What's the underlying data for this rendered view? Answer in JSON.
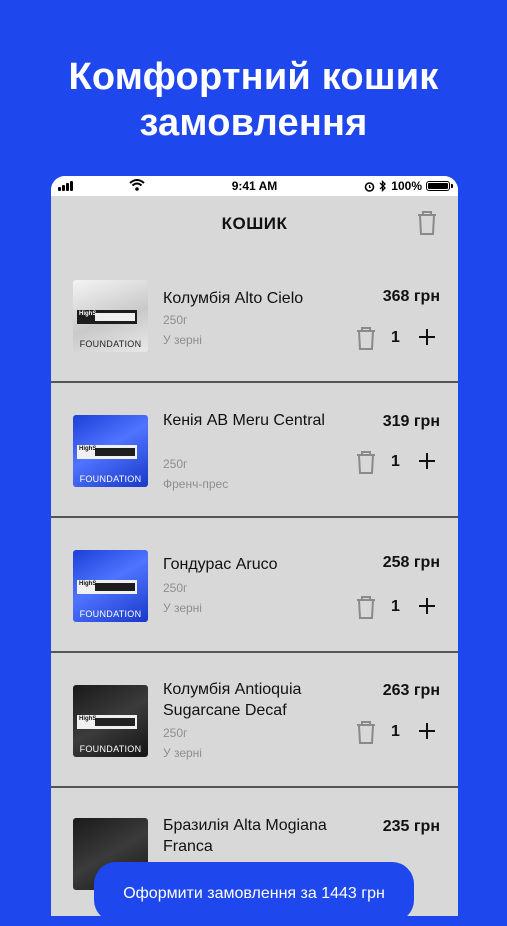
{
  "promo": {
    "headline_line1": "Комфортний кошик",
    "headline_line2": "замовлення"
  },
  "status_bar": {
    "time": "9:41 AM",
    "battery": "100%",
    "icons": [
      "signal-icon",
      "wifi-icon",
      "alarm-icon",
      "bluetooth-icon",
      "battery-icon"
    ]
  },
  "cart": {
    "title": "КОШИК",
    "clear_icon": "trash-icon",
    "items": [
      {
        "name": "Колумбія Alto Cielo",
        "weight": "250г",
        "grind": "У зерні",
        "price": "368 грн",
        "qty": "1",
        "pack_style": "grey",
        "pack_brand": "FOUNDATION",
        "pack_tag": "HighS"
      },
      {
        "name": "Кенія AB Meru Central",
        "weight": "250г",
        "grind": "Френч-прес",
        "price": "319 грн",
        "qty": "1",
        "pack_style": "blue",
        "pack_brand": "FOUNDATION",
        "pack_tag": "HighS"
      },
      {
        "name": "Гондурас Aruco",
        "weight": "250г",
        "grind": "У зерні",
        "price": "258 грн",
        "qty": "1",
        "pack_style": "blue",
        "pack_brand": "FOUNDATION",
        "pack_tag": "HighS"
      },
      {
        "name": "Колумбія Antioquia Sugarcane Decaf",
        "weight": "250г",
        "grind": "У зерні",
        "price": "263 грн",
        "qty": "1",
        "pack_style": "black",
        "pack_brand": "FOUNDATION",
        "pack_tag": "HighS"
      },
      {
        "name": "Бразилія Alta Mogiana Franca",
        "weight": "",
        "grind": "",
        "price": "235 грн",
        "qty": "",
        "pack_style": "black",
        "pack_brand": "",
        "pack_tag": ""
      }
    ],
    "checkout_label": "Оформити замовлення за 1443 грн"
  },
  "colors": {
    "accent": "#1f47ee",
    "background_panel": "#d8d8d8",
    "muted_text": "#8e8e8e"
  }
}
